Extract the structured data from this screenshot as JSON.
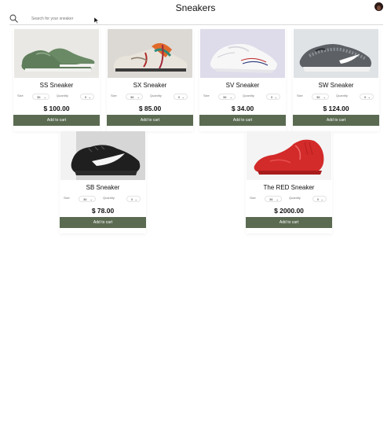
{
  "header": {
    "title": "Sneakers",
    "search_placeholder": "Search for your sneaker",
    "search_value": ""
  },
  "colors": {
    "button": "#5b6b52",
    "background": "#ffffff"
  },
  "labels": {
    "size": "Size",
    "quantity": "Quantity",
    "add_to_cart": "Add to cart"
  },
  "products": [
    {
      "name": "SS Sneaker",
      "size": "36",
      "quantity": "0",
      "price": "$ 100.00"
    },
    {
      "name": "SX Sneaker",
      "size": "36",
      "quantity": "0",
      "price": "$ 85.00"
    },
    {
      "name": "SV Sneaker",
      "size": "36",
      "quantity": "0",
      "price": "$ 34.00"
    },
    {
      "name": "SW Sneaker",
      "size": "36",
      "quantity": "0",
      "price": "$ 124.00"
    },
    {
      "name": "SB Sneaker",
      "size": "36",
      "quantity": "0",
      "price": "$ 78.00"
    },
    {
      "name": "The RED Sneaker",
      "size": "36",
      "quantity": "0",
      "price": "$ 2000.00"
    }
  ]
}
